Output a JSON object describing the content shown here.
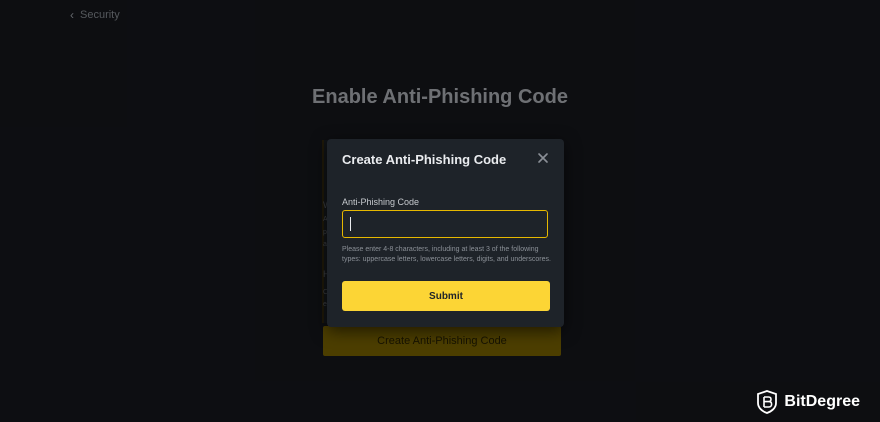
{
  "breadcrumb": {
    "label": "Security"
  },
  "page": {
    "title": "Enable Anti-Phishing Code",
    "create_button_label": "Create Anti-Phishing Code",
    "partial_letters": [
      "W",
      "A",
      "p",
      "a",
      "H",
      "C",
      "e"
    ]
  },
  "modal": {
    "title": "Create Anti-Phishing Code",
    "field_label": "Anti-Phishing Code",
    "input_value": "",
    "hint": "Please enter 4-8 characters, including at least 3 of the following types: uppercase letters, lowercase letters, digits, and underscores.",
    "submit_label": "Submit"
  },
  "watermark": {
    "name": "BitDegree"
  },
  "colors": {
    "accent": "#fcd535",
    "input_border": "#e6b800",
    "modal_bg": "#1e2329",
    "page_bg": "#181a20"
  }
}
